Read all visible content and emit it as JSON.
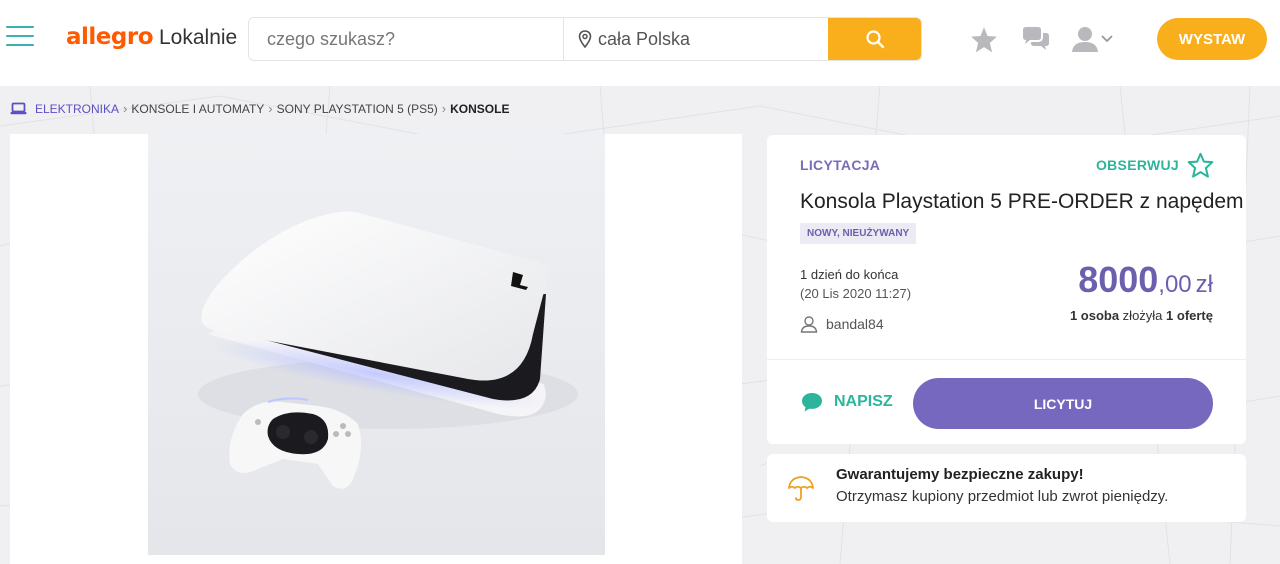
{
  "header": {
    "logo_brand": "allegro",
    "logo_sub": "Lokalnie",
    "search_placeholder": "czego szukasz?",
    "location_placeholder": "cała Polska",
    "sell_button": "WYSTAW"
  },
  "breadcrumb": {
    "items": [
      "ELEKTRONIKA",
      "KONSOLE I AUTOMATY",
      "SONY PLAYSTATION 5 (PS5)"
    ],
    "current": "KONSOLE"
  },
  "offer": {
    "type": "LICYTACJA",
    "observe_label": "OBSERWUJ",
    "title": "Konsola Playstation 5 PRE-ORDER z napędem",
    "condition": "NOWY, NIEUŻYWANY",
    "ends_in": "1 dzień do końca",
    "ends_date": "(20 Lis 2020 11:27)",
    "seller": "bandal84",
    "price_int": "8000",
    "price_dec": ",00",
    "currency": "zł",
    "bidders": "1 osoba",
    "offers_mid": " złożyła ",
    "offers_count": "1 ofertę",
    "message_label": "NAPISZ",
    "bid_button": "LICYTUJ"
  },
  "guarantee": {
    "title": "Gwarantujemy bezpieczne zakupy!",
    "text": "Otrzymasz kupiony przedmiot lub zwrot pieniędzy."
  },
  "colors": {
    "accent_orange": "#f9ae1b",
    "brand_orange": "#ff5a00",
    "purple": "#7768bf",
    "teal": "#2db59b"
  }
}
